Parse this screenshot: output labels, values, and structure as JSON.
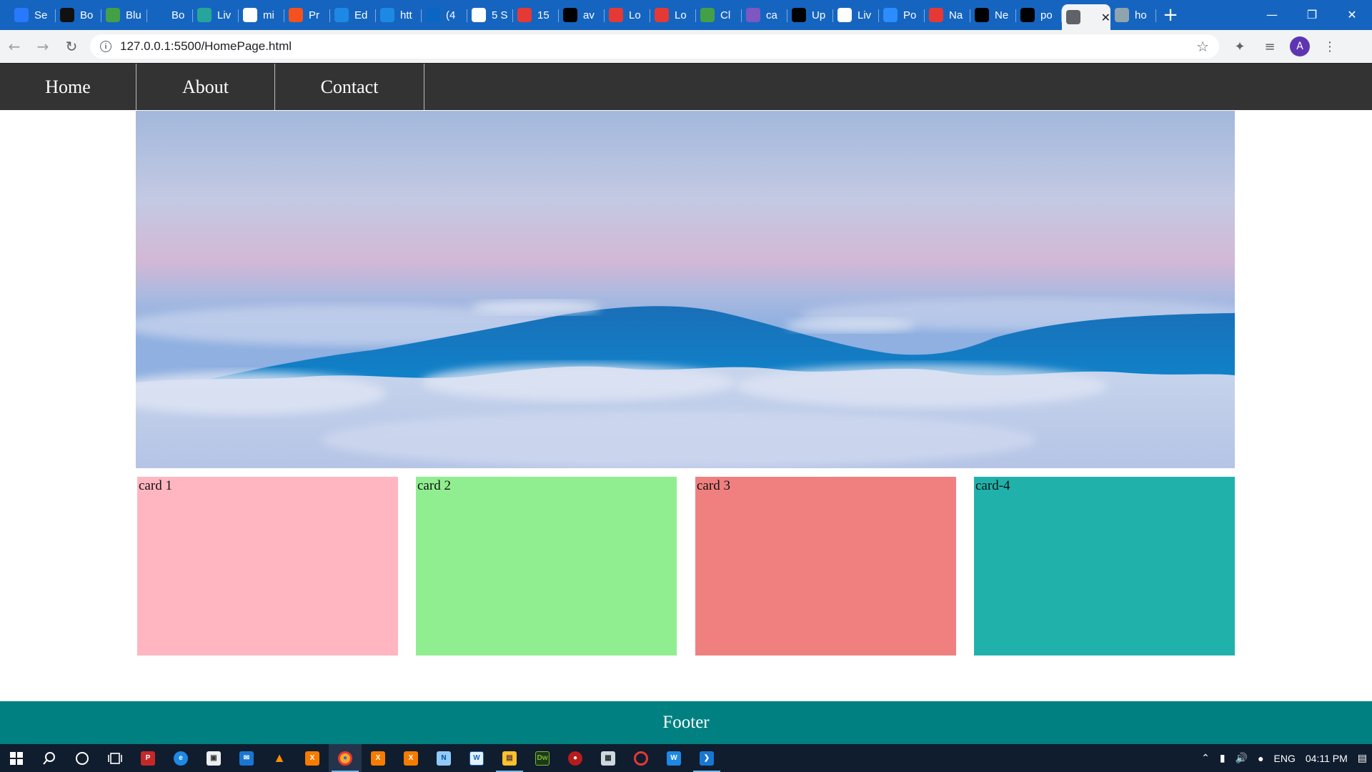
{
  "browser": {
    "tabs": [
      {
        "title": "Se",
        "icon": "gear-icon",
        "color": "#2979ff"
      },
      {
        "title": "Bo",
        "icon": "bootstrap-b-icon",
        "color": "#111111"
      },
      {
        "title": "Blu",
        "icon": "document-icon",
        "color": "#43a047"
      },
      {
        "title": "Bo",
        "icon": "mdb-icon",
        "color": "#1565c0"
      },
      {
        "title": "Liv",
        "icon": "shield-icon",
        "color": "#26a69a"
      },
      {
        "title": "mi",
        "icon": "google-icon",
        "color": "#ffffff"
      },
      {
        "title": "Pr",
        "icon": "grammarly-icon",
        "color": "#f4511e"
      },
      {
        "title": "Ed",
        "icon": "edge-icon",
        "color": "#1e88e5"
      },
      {
        "title": "htt",
        "icon": "edge-icon",
        "color": "#1e88e5"
      },
      {
        "title": "(4",
        "icon": "linkedin-icon",
        "color": "#0a66c2"
      },
      {
        "title": "5 S",
        "icon": "wordpress-icon",
        "color": "#ffffff"
      },
      {
        "title": "15",
        "icon": "bookmark-icon",
        "color": "#e53935"
      },
      {
        "title": "av",
        "icon": "github-icon",
        "color": "#000000"
      },
      {
        "title": "Lo",
        "icon": "udemy-icon",
        "color": "#e53935"
      },
      {
        "title": "Lo",
        "icon": "udemy-icon",
        "color": "#e53935"
      },
      {
        "title": "Cl",
        "icon": "leaf-icon",
        "color": "#43a047"
      },
      {
        "title": "ca",
        "icon": "heroku-icon",
        "color": "#7e57c2"
      },
      {
        "title": "Up",
        "icon": "github-icon",
        "color": "#000000"
      },
      {
        "title": "Liv",
        "icon": "gmail-icon",
        "color": "#ffffff"
      },
      {
        "title": "Po",
        "icon": "zoom-icon",
        "color": "#2d8cff"
      },
      {
        "title": "Na",
        "icon": "box-icon",
        "color": "#e53935"
      },
      {
        "title": "Ne",
        "icon": "github-icon",
        "color": "#000000"
      },
      {
        "title": "po",
        "icon": "codepen-icon",
        "color": "#000000"
      },
      {
        "title": "",
        "icon": "globe-icon",
        "color": "#5f6368"
      },
      {
        "title": "ho",
        "icon": "globe-icon",
        "color": "#90a4ae"
      }
    ],
    "active_tab_index": 23,
    "new_tab_label": "+",
    "url": "127.0.0.1:5500/HomePage.html",
    "profile_initial": "A"
  },
  "page": {
    "nav": {
      "home": "Home",
      "about": "About",
      "contact": "Contact"
    },
    "hero_alt": "",
    "cards": [
      {
        "label": "card 1",
        "color": "#ffb6c1"
      },
      {
        "label": "card 2",
        "color": "#90ee90"
      },
      {
        "label": "card 3",
        "color": "#f08080"
      },
      {
        "label": "card-4",
        "color": "#20b2aa"
      }
    ],
    "footer": "Footer"
  },
  "taskbar": {
    "apps": [
      "Windows",
      "Search",
      "Cortana",
      "Task View",
      "Paint",
      "Edge",
      "Store",
      "Mail",
      "VLC",
      "XAMPP",
      "Chrome",
      "XAMPP",
      "XAMPP",
      "Notepad",
      "Word",
      "Explorer",
      "Dreamweaver",
      "Unknown",
      "Calculator",
      "Opera",
      "Writer",
      "VS Code"
    ],
    "language": "ENG",
    "time": "04:11 PM"
  }
}
